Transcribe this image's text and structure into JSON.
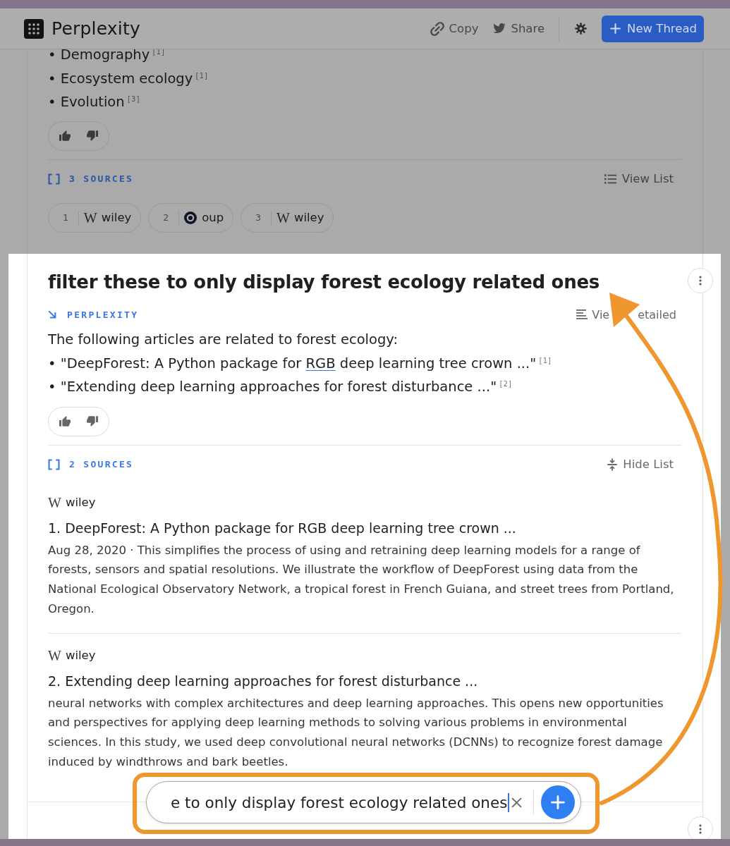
{
  "header": {
    "logo": "Perplexity",
    "copy_button": "Copy",
    "share_button": "Share",
    "new_thread_button": "New Thread"
  },
  "previous_answer": {
    "bullets": [
      "• Demography$^{[1]}$",
      "• Ecosystem ecology$^{[1]}$",
      "• Evolution$^{[3]}$"
    ],
    "sources": {
      "label": "3 SOURCES",
      "toggle": "View List",
      "expanded": false,
      "items": [
        {
          "number": "1",
          "site": "wiley",
          "logo": {
            "kind": "letter",
            "mark": "W"
          }
        },
        {
          "number": "2",
          "site": "oup",
          "logo": {
            "kind": "ring"
          }
        },
        {
          "number": "3",
          "site": "wiley",
          "logo": {
            "kind": "letter",
            "mark": "W"
          }
        }
      ]
    }
  },
  "thread": {
    "query": "filter these to only display forest ecology related ones",
    "answer_source": "PERPLEXITY",
    "view_toggle": [
      "Vie",
      "etailed"
    ],
    "intro": "The following articles are related to forest ecology:",
    "bullets": [
      {
        "text": "• \"DeepForest: A Python package for ",
        "link": "RGB",
        "text_after": " deep learning tree crown ...\"$^{[1]}$"
      },
      {
        "text": "• \"Extending deep learning approaches for forest disturbance ...\"$^{[2]}$"
      }
    ],
    "sources": {
      "label": "2 SOURCES",
      "toggle": "Hide List",
      "expanded": true,
      "items": [
        {
          "site": "wiley",
          "logo": {
            "kind": "letter",
            "mark": "W"
          },
          "title": "1. DeepForest: A Python package for RGB deep learning tree crown ...",
          "snippet": "Aug 28, 2020 · This simplifies the process of using and retraining deep learning models for a range of forests, sensors and spatial resolutions. We illustrate the workflow of DeepForest using data from the National Ecological Observatory Network, a tropical forest in French Guiana, and street trees from Portland, Oregon."
        },
        {
          "site": "wiley",
          "logo": {
            "kind": "letter",
            "mark": "W"
          },
          "title": "2. Extending deep learning approaches for forest disturbance ...",
          "snippet": "neural networks with complex architectures and deep learning approaches. This opens new opportunities and perspectives for applying deep learning methods to solving various problems in environmental sciences. In this study, we used deep convolutional neural networks (DCNNs) to recognize forest damage induced by windthrows and bark beetles."
        }
      ]
    }
  },
  "composer": {
    "value": "e to only display forest ecology related ones"
  }
}
